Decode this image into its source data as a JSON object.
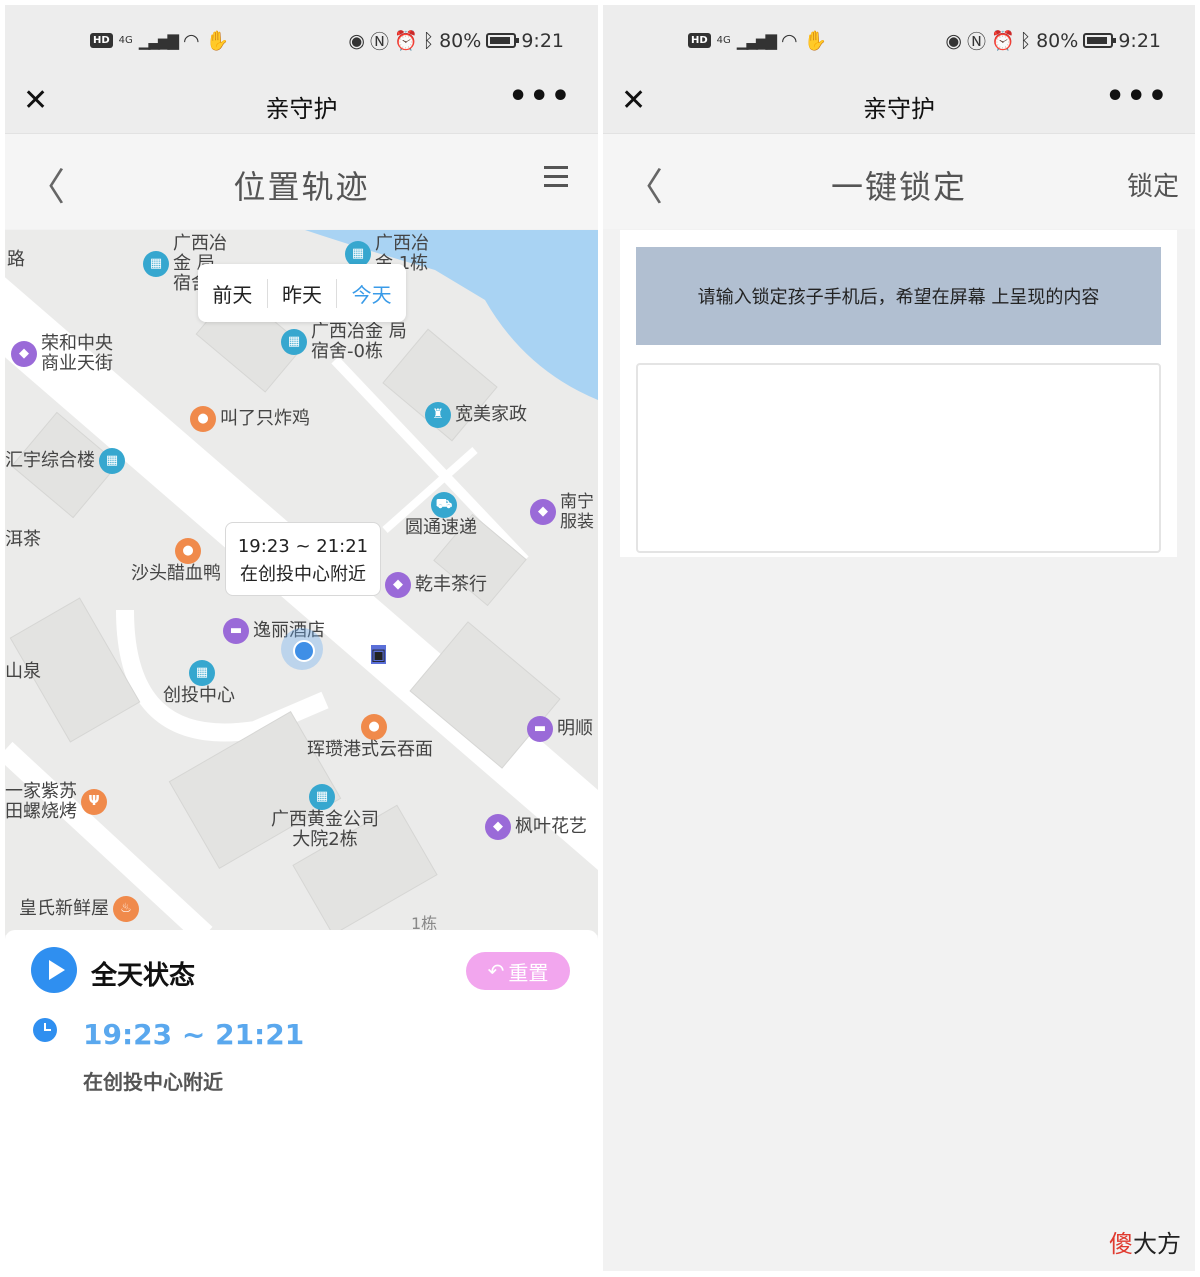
{
  "status_bar": {
    "hd": "HD",
    "network": "4G",
    "battery": "80%",
    "time": "9:21"
  },
  "wechat_bar": {
    "close": "✕",
    "title": "亲守护",
    "more": "•••"
  },
  "location_page": {
    "title": "位置轨迹",
    "day_tabs": [
      "前天",
      "昨天",
      "今天"
    ],
    "active_tab": "今天",
    "map_pois": [
      "广西冶金 局宿舍",
      "广西冶金 1栋",
      "荣和中央 商业天街",
      "广西冶金 局宿舍-0栋",
      "叫了只炸鸡",
      "宽美家政",
      "汇宇综合楼",
      "南宁 服装",
      "洱茶",
      "圆通速递",
      "沙头醋血鸭",
      "乾丰茶行",
      "逸丽酒店",
      "山泉",
      "创投中心",
      "明顺",
      "珲瓒港式云吞面",
      "一家紫苏 田螺烧烤",
      "广西黄金公司 大院2栋",
      "枫叶花艺",
      "皇氏新鲜屋",
      "1栋",
      "路"
    ],
    "callout": {
      "time": "19:23 ~ 21:21",
      "place": "在创投中心附近"
    },
    "status_card": {
      "title": "全天状态",
      "reset_label": "重置",
      "segment_time": "19:23 ~ 21:21",
      "segment_place": "在创投中心附近"
    }
  },
  "lock_page": {
    "title": "一键锁定",
    "action": "锁定",
    "hint": "请输入锁定孩子手机后，希望在屏幕 上呈现的内容",
    "textarea_value": ""
  },
  "watermark": {
    "mark": "傻",
    "text": "大方"
  },
  "colors": {
    "accent_blue": "#2f8ff0",
    "active_tab": "#3a9be8",
    "reset_pink": "#f2a6ee",
    "hint_bg": "#b1bfd1"
  }
}
